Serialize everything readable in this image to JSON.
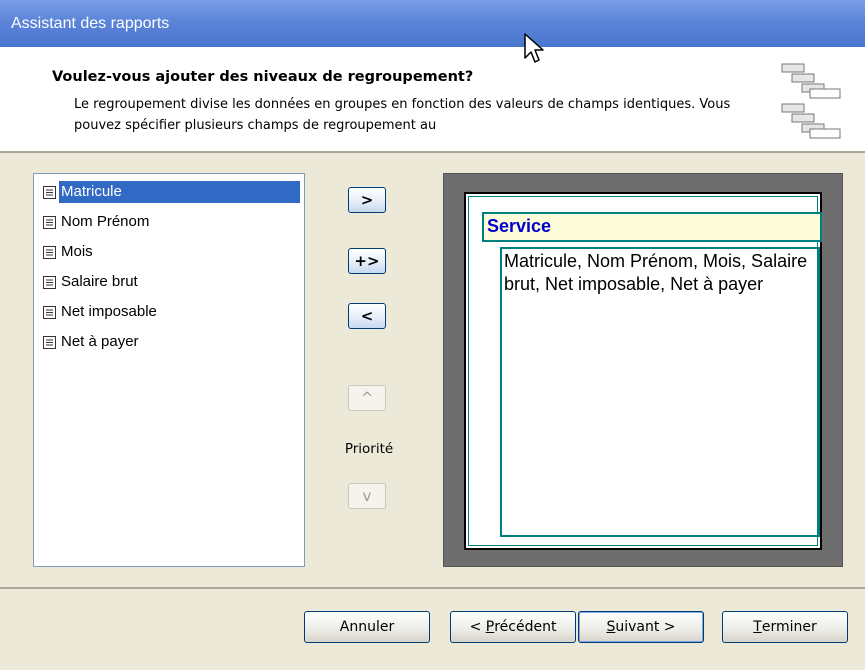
{
  "window": {
    "title": "Assistant des rapports"
  },
  "header": {
    "title": "Voulez-vous ajouter des niveaux de regroupement?",
    "description": "Le regroupement divise les données en groupes en fonction des valeurs de champs identiques. Vous pouvez spécifier plusieurs champs de regroupement au"
  },
  "fields": [
    {
      "label": "Matricule",
      "selected": true
    },
    {
      "label": "Nom Prénom"
    },
    {
      "label": "Mois"
    },
    {
      "label": "Salaire brut"
    },
    {
      "label": "Net imposable"
    },
    {
      "label": "Net à payer"
    }
  ],
  "controls": {
    "add": ">",
    "add_all": "+>",
    "remove": "<",
    "priority_up": "^",
    "priority_label": "Priorité",
    "priority_down": "v"
  },
  "preview": {
    "group_field": "Service",
    "detail_fields": "Matricule, Nom Prénom, Mois, Salaire brut, Net imposable, Net à payer"
  },
  "buttons": {
    "cancel": "Annuler",
    "previous": {
      "key": "P",
      "before": "< ",
      "rest": "récédent"
    },
    "next": {
      "key": "S",
      "rest": "uivant >"
    },
    "finish": {
      "key": "T",
      "rest": "erminer"
    }
  }
}
